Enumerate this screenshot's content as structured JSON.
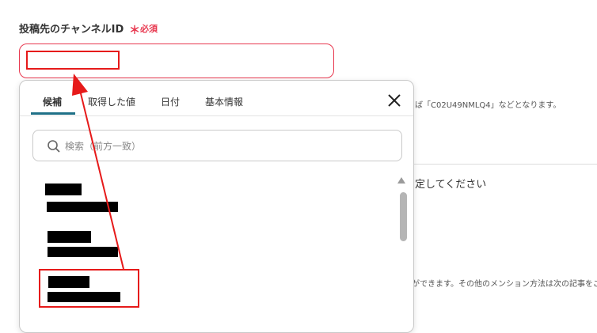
{
  "field": {
    "label": "投稿先のチャンネルID",
    "required_mark": "＊",
    "required_text": "必須",
    "input_value": ""
  },
  "background": {
    "hint_text": "ば「C02U49NMLQ4」などとなります。",
    "text2": "定してください",
    "text3": "ができます。その他のメンション方法は次の記事をご"
  },
  "popup": {
    "tabs": [
      {
        "label": "候補",
        "active": true
      },
      {
        "label": "取得した値",
        "active": false
      },
      {
        "label": "日付",
        "active": false
      },
      {
        "label": "基本情報",
        "active": false
      }
    ],
    "close_icon": "close-icon",
    "search": {
      "placeholder": "検索（前方一致）",
      "value": ""
    },
    "items_note": "list item text is redacted (black bars)"
  },
  "colors": {
    "required": "#e8384f",
    "tab_accent": "#1f7087",
    "annotation": "#e61a1a"
  }
}
